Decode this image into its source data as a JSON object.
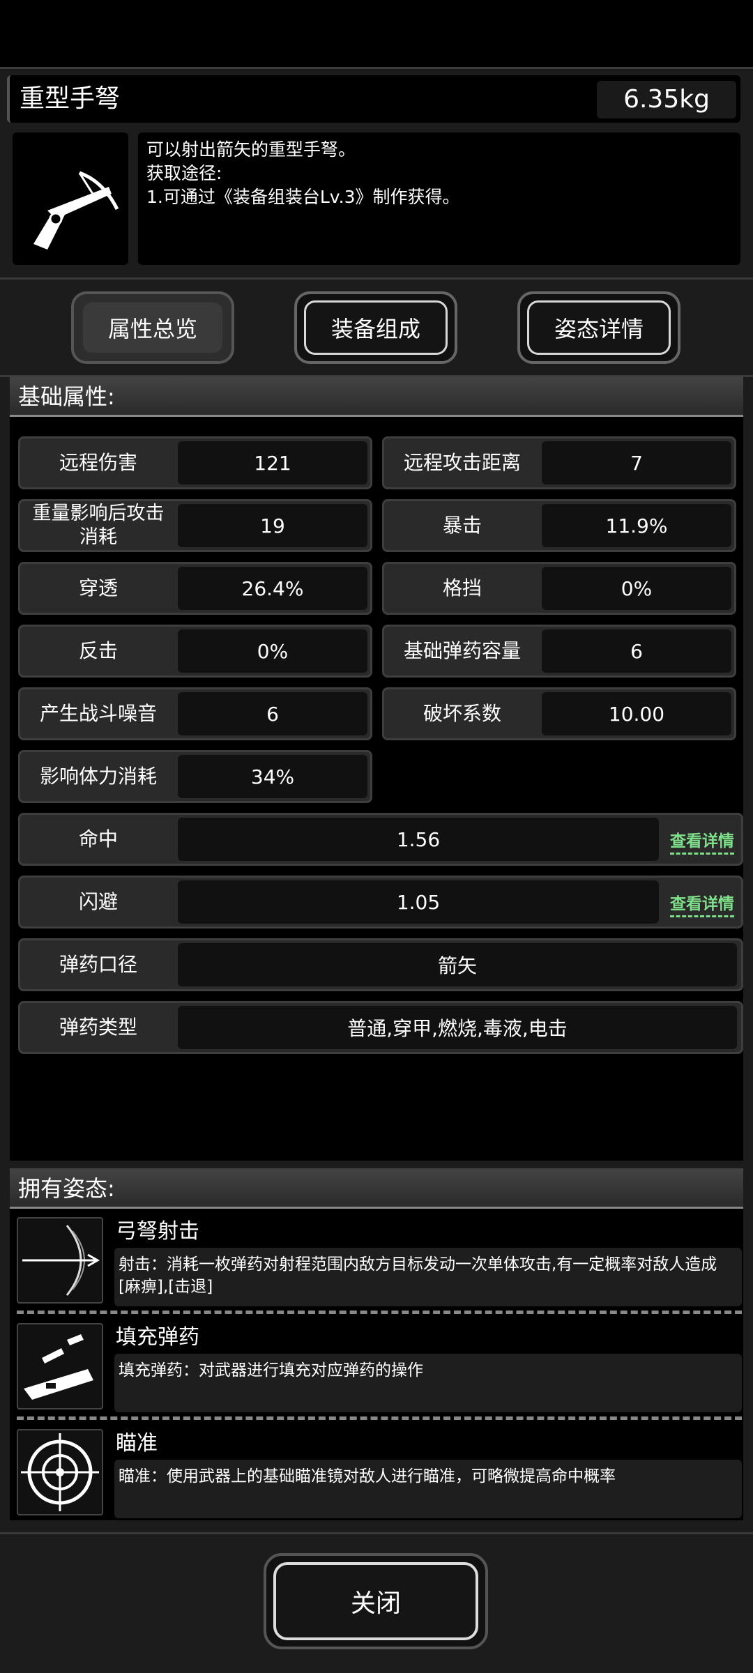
{
  "item": {
    "title": "重型手弩",
    "weight": "6.35kg",
    "description_lines": [
      "可以射出箭矢的重型手弩。",
      "获取途径:",
      "1.可通过《装备组装台Lv.3》制作获得。"
    ]
  },
  "tabs": [
    {
      "label": "属性总览",
      "active": true
    },
    {
      "label": "装备组成",
      "active": false
    },
    {
      "label": "姿态详情",
      "active": false
    }
  ],
  "base_section": {
    "title": "基础属性:",
    "pairs": [
      {
        "label": "远程伤害",
        "value": "121"
      },
      {
        "label": "远程攻击距离",
        "value": "7"
      },
      {
        "label": "重量影响后攻击消耗",
        "value": "19"
      },
      {
        "label": "暴击",
        "value": "11.9%"
      },
      {
        "label": "穿透",
        "value": "26.4%"
      },
      {
        "label": "格挡",
        "value": "0%"
      },
      {
        "label": "反击",
        "value": "0%"
      },
      {
        "label": "基础弹药容量",
        "value": "6"
      },
      {
        "label": "产生战斗噪音",
        "value": "6"
      },
      {
        "label": "破坏系数",
        "value": "10.00"
      },
      {
        "label": "影响体力消耗",
        "value": "34%"
      }
    ],
    "wide": [
      {
        "label": "命中",
        "value": "1.56",
        "link": "查看详情"
      },
      {
        "label": "闪避",
        "value": "1.05",
        "link": "查看详情"
      },
      {
        "label": "弹药口径",
        "value": "箭矢"
      },
      {
        "label": "弹药类型",
        "value": "普通,穿甲,燃烧,毒液,电击"
      }
    ]
  },
  "stance_section": {
    "title": "拥有姿态:",
    "stances": [
      {
        "name": "弓弩射击",
        "icon": "crossbow-shot-icon",
        "desc": "射击：消耗一枚弹药对射程范围内敌方目标发动一次单体攻击,有一定概率对敌人造成[麻痹],[击退]"
      },
      {
        "name": "填充弹药",
        "icon": "reload-ammo-icon",
        "desc": "填充弹药：对武器进行填充对应弹药的操作"
      },
      {
        "name": "瞄准",
        "icon": "crosshair-icon",
        "desc": "瞄准：使用武器上的基础瞄准镜对敌人进行瞄准，可略微提高命中概率"
      }
    ]
  },
  "close_label": "关闭",
  "colors": {
    "accent_link": "#7fe08a",
    "panel": "#2a2a2a",
    "background": "#000000"
  }
}
